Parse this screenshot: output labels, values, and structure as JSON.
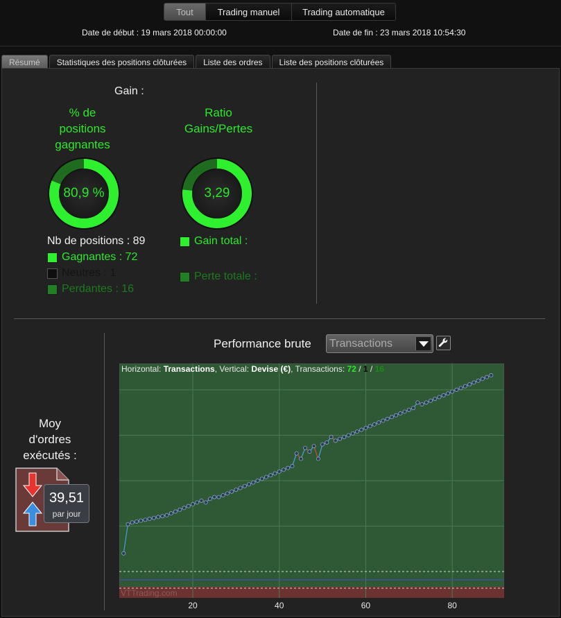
{
  "segmented": {
    "items": [
      "Tout",
      "Trading manuel",
      "Trading automatique"
    ],
    "active": 0
  },
  "dates": {
    "start": "Date de début : 19 mars 2018 00:00:00",
    "end": "Date de fin : 23 mars 2018 10:54:30"
  },
  "tabs": [
    "Résumé",
    "Statistiques des positions clôturées",
    "Liste des ordres",
    "Liste des positions clôturées"
  ],
  "gain": {
    "title": "Gain :",
    "winrate": {
      "label_lines": [
        "% de",
        "positions",
        "gagnantes"
      ],
      "value": "80,9 %",
      "fraction": 0.809
    },
    "ratio": {
      "label_lines": [
        "Ratio",
        "Gains/Pertes"
      ],
      "value": "3,29",
      "fraction": 0.767
    },
    "positions": {
      "total": "Nb de positions : 89",
      "gagnantes": "Gagnantes : 72",
      "neutres": "Neutres : 1",
      "perdantes": "Perdantes : 16"
    },
    "gain_total": "Gain total :",
    "perte_totale": "Perte totale :"
  },
  "orders": {
    "title_lines": [
      "Moy",
      "d'ordres",
      "exécutés :"
    ],
    "value": "39,51",
    "unit": "par jour"
  },
  "performance": {
    "title": "Performance brute",
    "select_value": "Transactions",
    "info": {
      "horizontal_label": "Horizontal: ",
      "horizontal_value": "Transactions",
      "vertical_label": ", Vertical: ",
      "vertical_value": "Devise (€)",
      "transactions_label": ", Transactions: ",
      "wins": "72",
      "sep1": " / ",
      "neutral": "1",
      "sep2": " / ",
      "losses": "16"
    },
    "watermark": "VTTrading.com"
  },
  "colors": {
    "accent_green": "#2ee82e",
    "dark_green": "#1e7a1e",
    "chart_bg": "#2e5934",
    "loss_band": "#6b3230"
  },
  "chart_data": {
    "type": "line",
    "title": "Performance brute",
    "xlabel": "Transactions",
    "ylabel": "Devise (€)",
    "x_ticks": [
      20,
      40,
      60,
      80
    ],
    "xlim": [
      3,
      92
    ],
    "ylim": [
      0,
      1
    ],
    "series": [
      {
        "x": [
          4,
          5,
          6,
          7,
          8,
          9,
          10,
          11,
          12,
          13,
          14,
          15,
          16,
          17,
          18,
          19,
          20,
          21,
          22,
          23,
          24,
          25,
          26,
          27,
          28,
          29,
          30,
          31,
          32,
          33,
          34,
          35,
          36,
          37,
          38,
          39,
          40,
          41,
          42,
          43,
          44,
          45,
          46,
          47,
          48,
          49,
          50,
          51,
          52,
          53,
          54,
          55,
          56,
          57,
          58,
          59,
          60,
          61,
          62,
          63,
          64,
          65,
          66,
          67,
          68,
          69,
          70,
          71,
          72,
          73,
          74,
          75,
          76,
          77,
          78,
          79,
          80,
          81,
          82,
          83,
          84,
          85,
          86,
          87,
          88,
          89
        ],
        "y": [
          0.1,
          0.26,
          0.27,
          0.275,
          0.28,
          0.285,
          0.29,
          0.295,
          0.3,
          0.305,
          0.31,
          0.32,
          0.33,
          0.34,
          0.35,
          0.36,
          0.37,
          0.38,
          0.39,
          0.38,
          0.4,
          0.41,
          0.41,
          0.42,
          0.43,
          0.44,
          0.45,
          0.46,
          0.47,
          0.48,
          0.49,
          0.5,
          0.51,
          0.52,
          0.53,
          0.54,
          0.55,
          0.56,
          0.57,
          0.58,
          0.65,
          0.62,
          0.68,
          0.66,
          0.69,
          0.62,
          0.7,
          0.71,
          0.74,
          0.72,
          0.73,
          0.74,
          0.75,
          0.76,
          0.77,
          0.78,
          0.79,
          0.8,
          0.81,
          0.82,
          0.83,
          0.84,
          0.85,
          0.86,
          0.87,
          0.88,
          0.89,
          0.9,
          0.93,
          0.92,
          0.93,
          0.94,
          0.95,
          0.96,
          0.97,
          0.98,
          0.99,
          1.0,
          1.01,
          1.02,
          1.03,
          1.04,
          1.05,
          1.06,
          1.07,
          1.08
        ]
      }
    ],
    "grid": true
  }
}
